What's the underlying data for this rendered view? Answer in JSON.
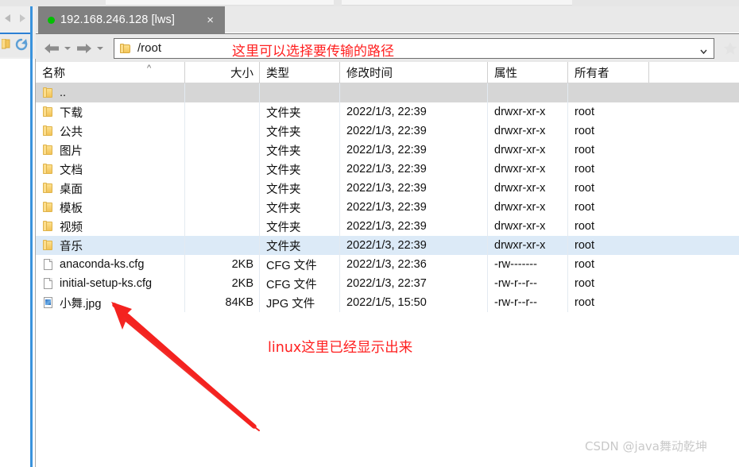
{
  "tab": {
    "label": "192.168.246.128 [lws]",
    "status_dot_color": "#00c000",
    "close_label": "×"
  },
  "toolbar": {
    "back_icon": "back-arrow-icon",
    "forward_icon": "forward-arrow-icon",
    "path_value": "/root",
    "path_icon": "folder-icon",
    "dropdown_icon": "chevron-down-icon",
    "favorite_icon": "star-icon"
  },
  "columns": [
    {
      "label": "名称",
      "align": "left"
    },
    {
      "label": "大小",
      "align": "right"
    },
    {
      "label": "类型",
      "align": "left"
    },
    {
      "label": "修改时间",
      "align": "left"
    },
    {
      "label": "属性",
      "align": "left"
    },
    {
      "label": "所有者",
      "align": "left"
    }
  ],
  "rows": [
    {
      "icon": "folder",
      "name": "..",
      "size": "",
      "type": "",
      "mtime": "",
      "attrs": "",
      "owner": "",
      "state": "selected"
    },
    {
      "icon": "folder",
      "name": "下载",
      "size": "",
      "type": "文件夹",
      "mtime": "2022/1/3, 22:39",
      "attrs": "drwxr-xr-x",
      "owner": "root",
      "state": ""
    },
    {
      "icon": "folder",
      "name": "公共",
      "size": "",
      "type": "文件夹",
      "mtime": "2022/1/3, 22:39",
      "attrs": "drwxr-xr-x",
      "owner": "root",
      "state": ""
    },
    {
      "icon": "folder",
      "name": "图片",
      "size": "",
      "type": "文件夹",
      "mtime": "2022/1/3, 22:39",
      "attrs": "drwxr-xr-x",
      "owner": "root",
      "state": ""
    },
    {
      "icon": "folder",
      "name": "文档",
      "size": "",
      "type": "文件夹",
      "mtime": "2022/1/3, 22:39",
      "attrs": "drwxr-xr-x",
      "owner": "root",
      "state": ""
    },
    {
      "icon": "folder",
      "name": "桌面",
      "size": "",
      "type": "文件夹",
      "mtime": "2022/1/3, 22:39",
      "attrs": "drwxr-xr-x",
      "owner": "root",
      "state": ""
    },
    {
      "icon": "folder",
      "name": "模板",
      "size": "",
      "type": "文件夹",
      "mtime": "2022/1/3, 22:39",
      "attrs": "drwxr-xr-x",
      "owner": "root",
      "state": ""
    },
    {
      "icon": "folder",
      "name": "视频",
      "size": "",
      "type": "文件夹",
      "mtime": "2022/1/3, 22:39",
      "attrs": "drwxr-xr-x",
      "owner": "root",
      "state": ""
    },
    {
      "icon": "folder",
      "name": "音乐",
      "size": "",
      "type": "文件夹",
      "mtime": "2022/1/3, 22:39",
      "attrs": "drwxr-xr-x",
      "owner": "root",
      "state": "highlight"
    },
    {
      "icon": "file",
      "name": "anaconda-ks.cfg",
      "size": "2KB",
      "type": "CFG 文件",
      "mtime": "2022/1/3, 22:36",
      "attrs": "-rw-------",
      "owner": "root",
      "state": ""
    },
    {
      "icon": "file",
      "name": "initial-setup-ks.cfg",
      "size": "2KB",
      "type": "CFG 文件",
      "mtime": "2022/1/3, 22:37",
      "attrs": "-rw-r--r--",
      "owner": "root",
      "state": ""
    },
    {
      "icon": "image",
      "name": "小舞.jpg",
      "size": "84KB",
      "type": "JPG 文件",
      "mtime": "2022/1/5, 15:50",
      "attrs": "-rw-r--r--",
      "owner": "root",
      "state": ""
    }
  ],
  "annotations": {
    "path_note": "这里可以选择要传输的路径",
    "file_note": "linux这里已经显示出来",
    "color": "#ff2020",
    "arrow_icon": "red-arrow-icon"
  },
  "watermark": {
    "text": "CSDN @java舞动乾坤"
  },
  "host_window": {
    "back_icon": "back-chevron-icon",
    "forward_icon": "forward-chevron-icon",
    "refresh_icon": "refresh-icon",
    "folder_icon": "folder-icon"
  }
}
